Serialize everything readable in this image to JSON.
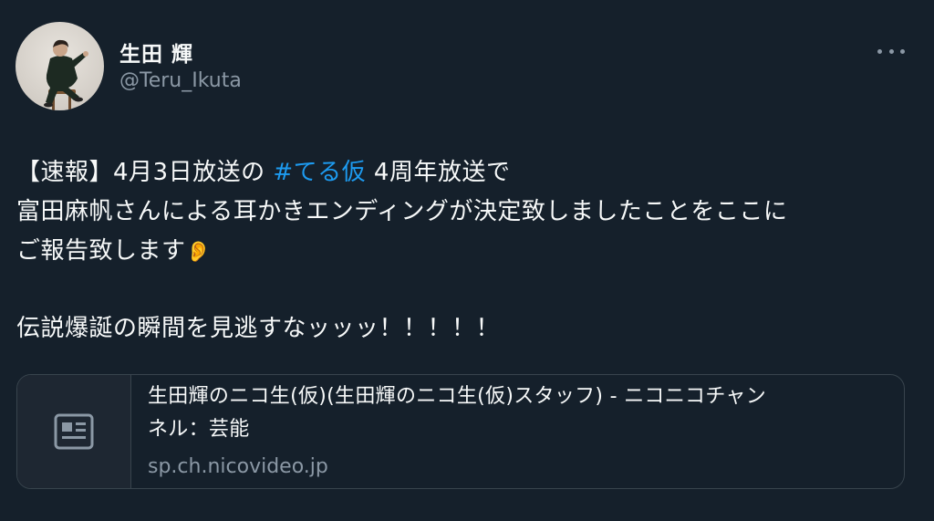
{
  "author": {
    "display_name": "生田 輝",
    "handle": "@Teru_Ikuta",
    "avatar_icon": "profile-photo-person-seated"
  },
  "more_icon": "ellipsis-icon",
  "tweet": {
    "line1_prefix": "【速報】4月3日放送の ",
    "hashtag": "#てる仮",
    "line1_suffix": " 4周年放送で",
    "line2": "富田麻帆さんによる耳かきエンディングが決定致しましたことをここに",
    "line3": "ご報告致します",
    "line3_emoji": "👂",
    "line4": "伝説爆誕の瞬間を見逃すなッッッ！！！！！"
  },
  "link_card": {
    "title_line1": "生田輝のニコ生(仮)(生田輝のニコ生(仮)スタッフ) - ニコニコチャン",
    "title_line2": "ネル：芸能",
    "domain": "sp.ch.nicovideo.jp",
    "thumb_icon": "article-icon"
  },
  "colors": {
    "background": "#15202b",
    "text": "#f7f9f9",
    "secondary": "#8b98a5",
    "link": "#1d9bf0",
    "border": "#38444d"
  }
}
